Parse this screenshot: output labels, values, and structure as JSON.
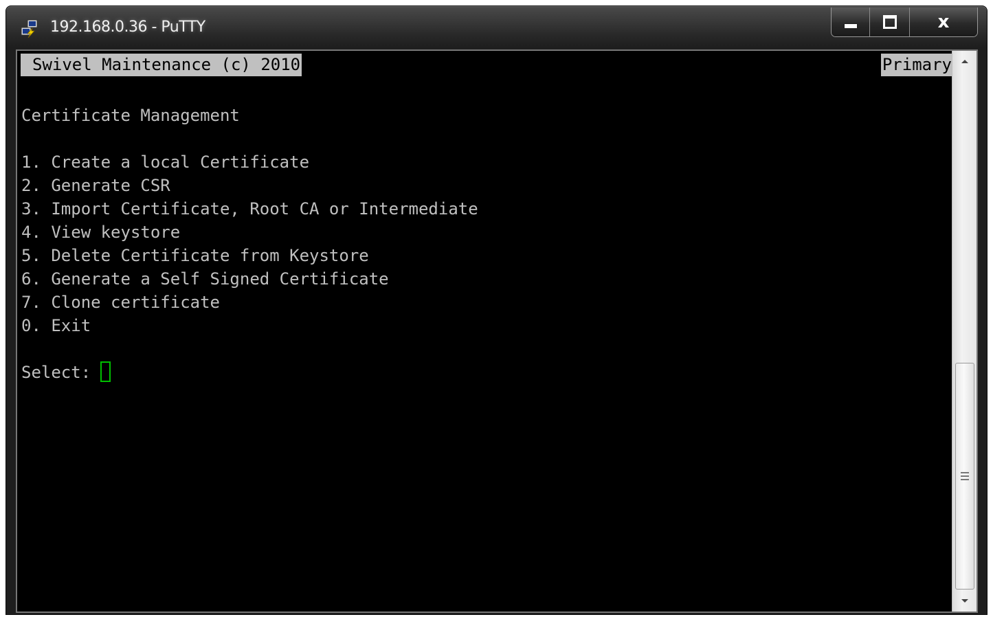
{
  "window": {
    "title": "192.168.0.36 - PuTTY",
    "app_icon": "putty-icon",
    "buttons": {
      "minimize": "minimize-icon",
      "maximize": "maximize-icon",
      "close": "x"
    }
  },
  "terminal": {
    "header": "Swivel Maintenance (c) 2010",
    "status_tag": "Primary",
    "heading": "Certificate Management",
    "menu_items": [
      "1. Create a local Certificate",
      "2. Generate CSR",
      "3. Import Certificate, Root CA or Intermediate",
      "4. View keystore",
      "5. Delete Certificate from Keystore",
      "6. Generate a Self Signed Certificate",
      "7. Clone certificate",
      "0. Exit"
    ],
    "prompt": "Select:",
    "colors": {
      "background": "#000000",
      "text": "#c0c0c0",
      "header_bg": "#c0c0c0",
      "cursor": "#00c000"
    }
  },
  "scrollbar": {
    "up_icon": "arrow-up-icon",
    "down_icon": "arrow-down-icon"
  }
}
